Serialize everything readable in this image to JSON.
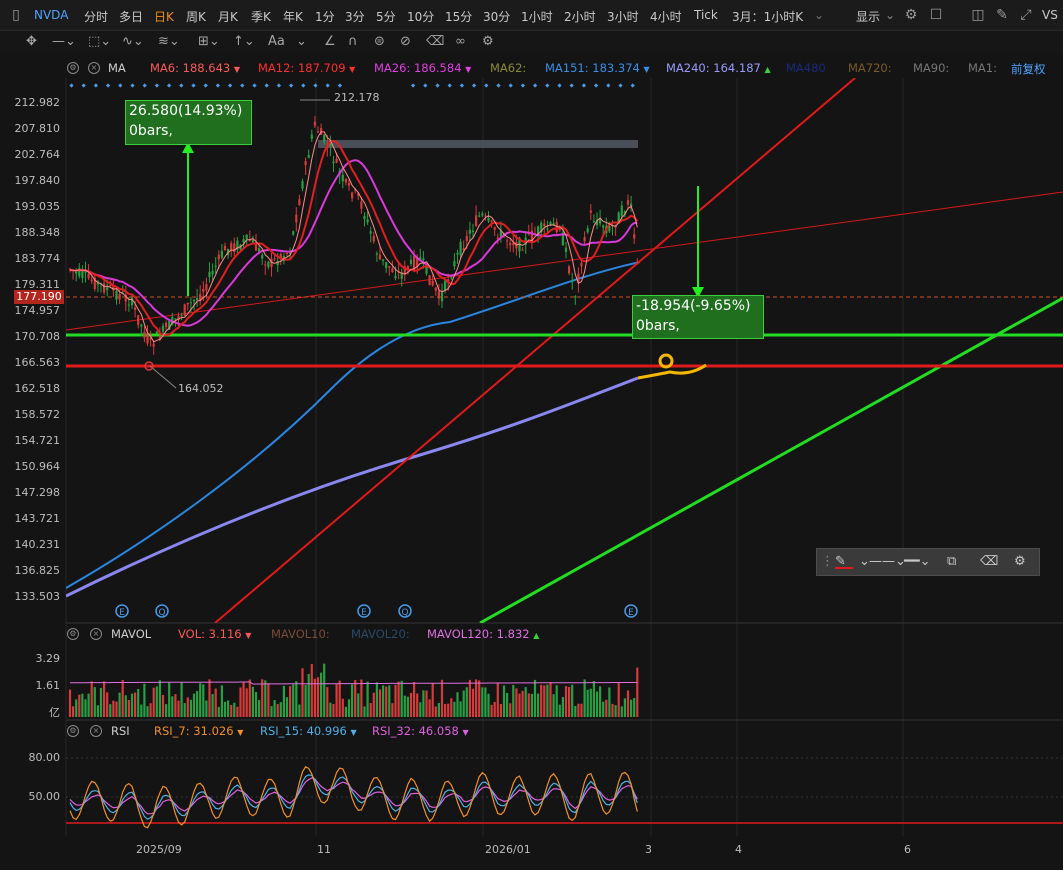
{
  "topbar": {
    "symbol": "NVDA",
    "timeframes": [
      "分时",
      "多日",
      "日K",
      "周K",
      "月K",
      "季K",
      "年K",
      "1分",
      "3分",
      "5分",
      "10分",
      "15分",
      "30分",
      "1小时",
      "2小时",
      "3小时",
      "4小时",
      "Tick"
    ],
    "active_timeframe": "日K",
    "period_select": "3月：1小时K",
    "display_label": "显示",
    "vs_label": "VS"
  },
  "main_indicator": {
    "name": "MA",
    "items": [
      {
        "label": "MA6:",
        "value": "188.643",
        "color": "#ff5a5a",
        "arrow": "▼"
      },
      {
        "label": "MA12:",
        "value": "187.709",
        "color": "#ff3030",
        "arrow": "▼"
      },
      {
        "label": "MA26:",
        "value": "186.584",
        "color": "#e040e0",
        "arrow": "▼"
      },
      {
        "label": "MA62:",
        "value": "",
        "color": "#8a8a3a",
        "arrow": ""
      },
      {
        "label": "MA151:",
        "value": "183.374",
        "color": "#3a8fe6",
        "arrow": "▼"
      },
      {
        "label": "MA240:",
        "value": "164.187",
        "color": "#9a9aff",
        "arrow": "▲"
      },
      {
        "label": "MA480",
        "value": "",
        "color": "#1a2a7a",
        "arrow": ""
      },
      {
        "label": "MA720:",
        "value": "",
        "color": "#7a5a2a",
        "arrow": ""
      },
      {
        "label": "MA90:",
        "value": "",
        "color": "#777777",
        "arrow": ""
      },
      {
        "label": "MA1:",
        "value": "",
        "color": "#777777",
        "arrow": ""
      }
    ],
    "adjust_label": "前复权"
  },
  "price_axis": {
    "labels": [
      "212.982",
      "207.810",
      "202.764",
      "197.840",
      "193.035",
      "188.348",
      "183.774",
      "179.311",
      "174.957",
      "170.708",
      "166.563",
      "162.518",
      "158.572",
      "154.721",
      "150.964",
      "147.298",
      "143.721",
      "140.231",
      "136.825",
      "133.503"
    ],
    "current_price": "177.190"
  },
  "annotations": {
    "high_label": "212.178",
    "low_label": "164.052",
    "up_measure": {
      "line1": "26.580(14.93%)",
      "line2": "0bars,"
    },
    "down_measure": {
      "line1": "-18.954(-9.65%)",
      "line2": "0bars,"
    },
    "event_markers": [
      "E",
      "Q",
      "E",
      "Q",
      "E"
    ]
  },
  "volume_indicator": {
    "name": "MAVOL",
    "items": [
      {
        "label": "VOL:",
        "value": "3.116",
        "color": "#ff5a5a",
        "arrow": "▼"
      },
      {
        "label": "MAVOL10:",
        "value": "",
        "color": "#7a4a3a",
        "arrow": ""
      },
      {
        "label": "MAVOL20:",
        "value": "",
        "color": "#2a4a6a",
        "arrow": ""
      },
      {
        "label": "MAVOL120:",
        "value": "1.832",
        "color": "#e070e0",
        "arrow": "▲"
      }
    ],
    "axis": [
      "3.29",
      "1.61",
      "亿"
    ]
  },
  "rsi_indicator": {
    "name": "RSI",
    "items": [
      {
        "label": "RSI_7:",
        "value": "31.026",
        "color": "#f0902a",
        "arrow": "▼"
      },
      {
        "label": "RSI_15:",
        "value": "40.996",
        "color": "#4fb0e6",
        "arrow": "▼"
      },
      {
        "label": "RSI_32:",
        "value": "46.058",
        "color": "#e060e0",
        "arrow": "▼"
      }
    ],
    "axis": [
      "80.00",
      "50.00"
    ]
  },
  "time_axis": [
    "2025/09",
    "11",
    "2026/01",
    "3",
    "4",
    "6"
  ],
  "colors": {
    "up": "#26a042",
    "down": "#d63a3a",
    "green_line": "#22dd22",
    "red_line": "#e01a1a",
    "ma240": "#8a88f0",
    "ma151": "#2a86e0",
    "ma26": "#d83ad8",
    "highlight": "#f5b800"
  }
}
